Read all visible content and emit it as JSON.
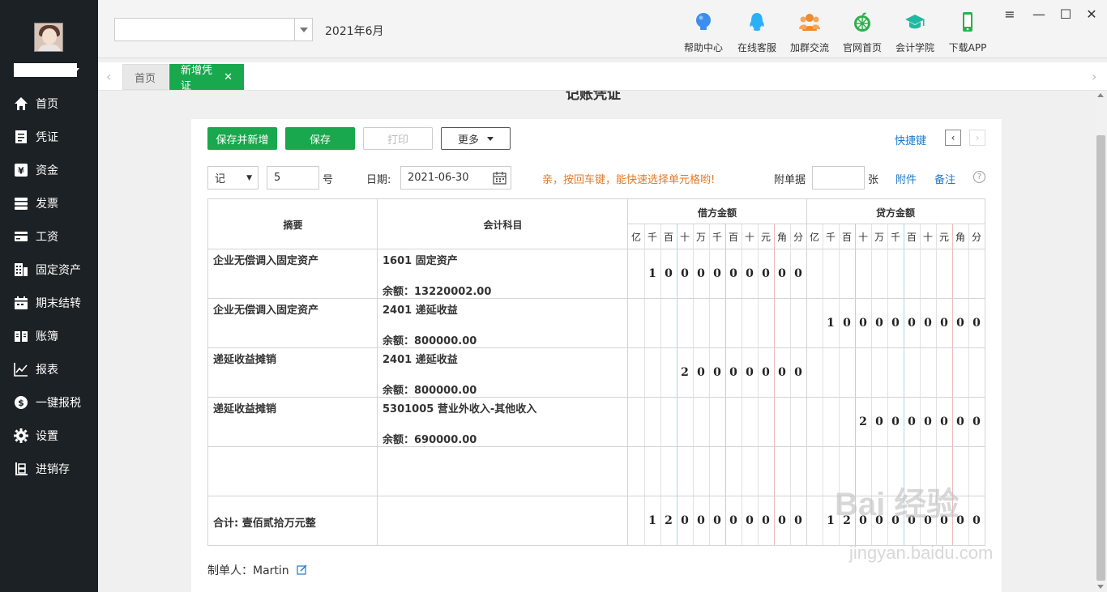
{
  "sidebar": {
    "items": [
      {
        "label": "首页",
        "icon": "home-icon"
      },
      {
        "label": "凭证",
        "icon": "voucher-icon"
      },
      {
        "label": "资金",
        "icon": "yen-icon"
      },
      {
        "label": "发票",
        "icon": "invoice-icon"
      },
      {
        "label": "工资",
        "icon": "salary-card-icon"
      },
      {
        "label": "固定资产",
        "icon": "building-icon"
      },
      {
        "label": "期末结转",
        "icon": "calendar-icon"
      },
      {
        "label": "账簿",
        "icon": "book-icon"
      },
      {
        "label": "报表",
        "icon": "chart-icon"
      },
      {
        "label": "一键报税",
        "icon": "dollar-circle-icon"
      },
      {
        "label": "设置",
        "icon": "gear-icon"
      },
      {
        "label": "进销存",
        "icon": "inventory-icon"
      }
    ]
  },
  "header": {
    "period": "2021年6月",
    "tools": [
      {
        "label": "帮助中心",
        "icon": "help-bulb-icon",
        "color": "#3b8ef0"
      },
      {
        "label": "在线客服",
        "icon": "qq-chat-icon",
        "color": "#2ab0f5"
      },
      {
        "label": "加群交流",
        "icon": "group-people-icon",
        "color": "#f08a2c"
      },
      {
        "label": "官网首页",
        "icon": "orange-fruit-icon",
        "color": "#2fae4e"
      },
      {
        "label": "会计学院",
        "icon": "graduation-cap-icon",
        "color": "#1fb8a0"
      },
      {
        "label": "下载APP",
        "icon": "mobile-phone-icon",
        "color": "#2fae4e"
      }
    ]
  },
  "tabs": {
    "home": "首页",
    "active": "新增凭证",
    "close": "✕"
  },
  "voucher": {
    "title": "记账凭证",
    "buttons": {
      "save_new": "保存并新增",
      "save": "保存",
      "print": "打印",
      "more": "更多"
    },
    "shortcut": "快捷键",
    "type_value": "记",
    "number_value": "5",
    "number_suffix": "号",
    "date_label": "日期:",
    "date_value": "2021-06-30",
    "hint": "亲，按回车键，能快速选择单元格哟!",
    "attach_label": "附单据",
    "attach_unit": "张",
    "attachment_link": "附件",
    "note_link": "备注",
    "help": "?",
    "headers": {
      "abstract": "摘要",
      "account": "会计科目",
      "debit": "借方金额",
      "credit": "贷方金额",
      "units": [
        "亿",
        "千",
        "百",
        "十",
        "万",
        "千",
        "百",
        "十",
        "元",
        "角",
        "分"
      ]
    },
    "rows": [
      {
        "abstract": "企业无偿调入固定资产",
        "account": "1601 固定资产",
        "balance": "余额：13220002.00",
        "debit": "1000000000",
        "credit": ""
      },
      {
        "abstract": "企业无偿调入固定资产",
        "account": "2401 递延收益",
        "balance": "余额：800000.00",
        "debit": "",
        "credit": "1000000000"
      },
      {
        "abstract": "递延收益摊销",
        "account": "2401 递延收益",
        "balance": "余额：800000.00",
        "debit": "20000000",
        "credit": ""
      },
      {
        "abstract": "递延收益摊销",
        "account": "5301005 营业外收入-其他收入",
        "balance": "余额：690000.00",
        "debit": "",
        "credit": "20000000"
      },
      {
        "abstract": "",
        "account": "",
        "balance": "",
        "debit": "",
        "credit": ""
      }
    ],
    "total": {
      "label": "合计: 壹佰贰拾万元整",
      "debit": "1200000000",
      "credit": "1200000000"
    },
    "maker_label": "制单人：",
    "maker_name": "Martin"
  },
  "watermark": {
    "text": "Bai 经验",
    "sub": "jingyan.baidu.com"
  }
}
